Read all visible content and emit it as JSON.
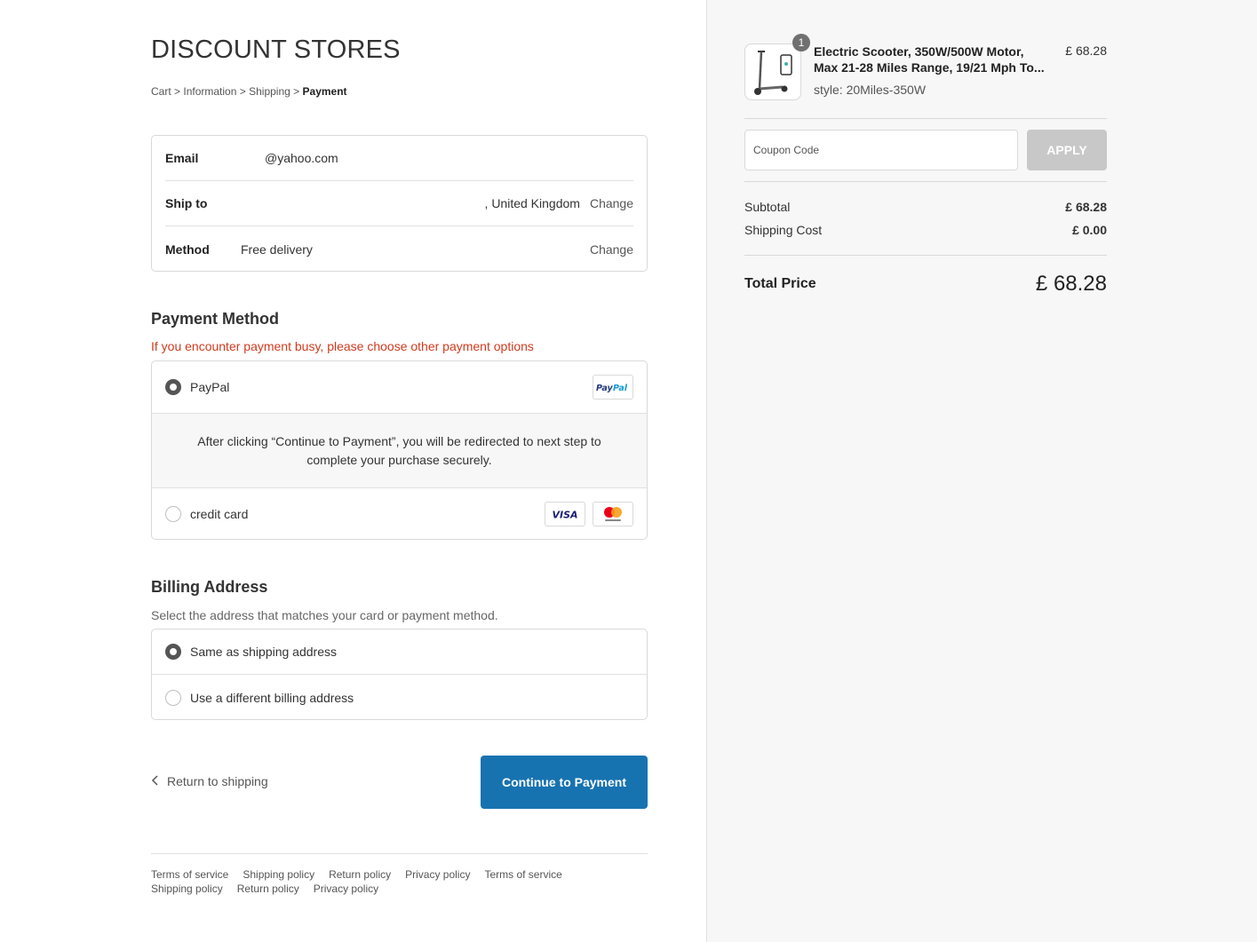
{
  "store": {
    "title": "DISCOUNT STORES"
  },
  "breadcrumb": {
    "cart": "Cart",
    "information": "Information",
    "shipping": "Shipping",
    "payment": "Payment",
    "separator": ">"
  },
  "info": {
    "email_label": "Email",
    "email_value": "@yahoo.com",
    "ship_label": "Ship to",
    "ship_value": ", United Kingdom",
    "method_label": "Method",
    "method_value": "Free delivery",
    "change": "Change"
  },
  "payment": {
    "title": "Payment Method",
    "warning": "If you encounter payment busy, please choose other payment options",
    "paypal_label": "PayPal",
    "paypal_info": "After clicking “Continue to Payment”, you will be redirected to next step to complete your purchase securely.",
    "card_label": "credit card",
    "visa": "VISA",
    "mastercard": "mastercard",
    "paypal_badge": "PayPal"
  },
  "billing": {
    "title": "Billing Address",
    "hint": "Select the address that matches your card or payment method.",
    "same": "Same as shipping address",
    "different": "Use a different billing address"
  },
  "actions": {
    "return": "Return to shipping",
    "continue": "Continue to Payment"
  },
  "footer": {
    "links": [
      "Terms of service",
      "Shipping policy",
      "Return policy",
      "Privacy policy",
      "Terms of service",
      "Shipping policy",
      "Return policy",
      "Privacy policy"
    ]
  },
  "summary": {
    "product_name_1": "Electric Scooter, 350W/500W Motor,",
    "product_name_2": "Max 21-28 Miles Range, 19/21 Mph To...",
    "product_style": "style: 20Miles-350W",
    "product_price": "£ 68.28",
    "quantity": "1",
    "coupon_placeholder": "Coupon Code",
    "apply": "APPLY",
    "subtotal_label": "Subtotal",
    "subtotal_value": "£ 68.28",
    "shipping_label": "Shipping Cost",
    "shipping_value": "£ 0.00",
    "total_label": "Total Price",
    "total_value": "£ 68.28"
  },
  "colors": {
    "primary": "#1773b0",
    "warning": "#d13a1e",
    "apply_disabled": "#c8c8c8"
  },
  "icons": {
    "back": "chevron-left-icon"
  }
}
